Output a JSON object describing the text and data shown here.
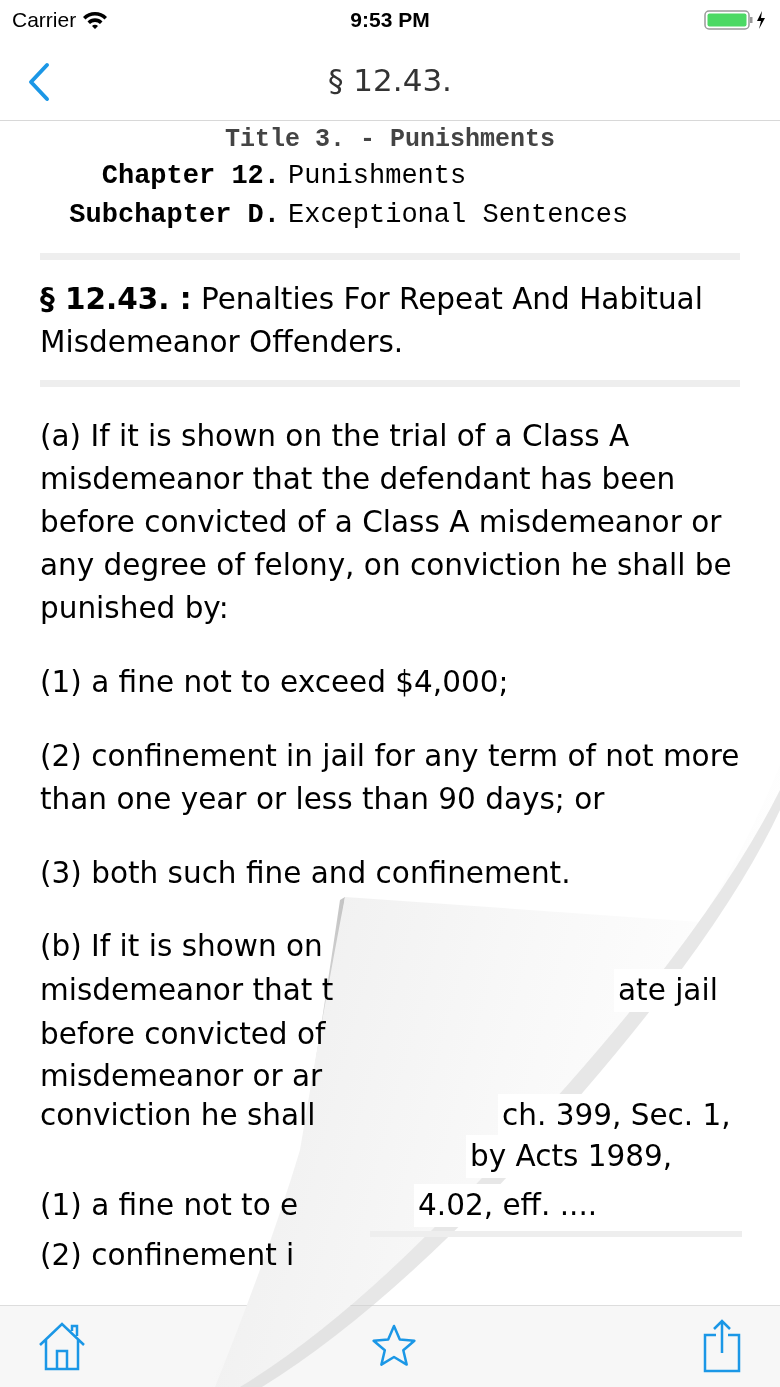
{
  "status_bar": {
    "carrier": "Carrier",
    "time": "9:53 PM"
  },
  "nav": {
    "title": "§ 12.43."
  },
  "header": {
    "title": "Title 3. - Punishments",
    "rows": [
      {
        "label": "Chapter 12.",
        "value": "Punishments"
      },
      {
        "label": "Subchapter D.",
        "value": "Exceptional Sentences"
      }
    ]
  },
  "section_heading": "**§ 12.43. :** Penalties For Repeat And Habitual Misdemeanor Offenders.",
  "paragraphs": [
    "(a) If it is shown on the trial of a Class A misdemeanor that the defendant has been before convicted of a Class A misdemeanor or any degree of felony, on conviction he shall be punished by:",
    "(1) a fine not to exceed $4,000;",
    "(2) confinement in jail for any term of not more than one year or less than 90 days; or",
    "(3) both such fine and confinement."
  ],
  "partial_lines": [
    {
      "left": "(b) If it is shown on"
    },
    {
      "left": "misdemeanor that t",
      "right": "ate jail"
    },
    {
      "left": "before convicted of"
    },
    {
      "left": "misdemeanor or ar"
    },
    {
      "left": "conviction he shall",
      "right": "ch. 399, Sec. 1,"
    },
    {
      "right": "by Acts 1989,"
    },
    {
      "left": "(1) a fine not to e",
      "right": "4.02, eff. ...."
    },
    {
      "left": "(2) confinement i"
    }
  ]
}
